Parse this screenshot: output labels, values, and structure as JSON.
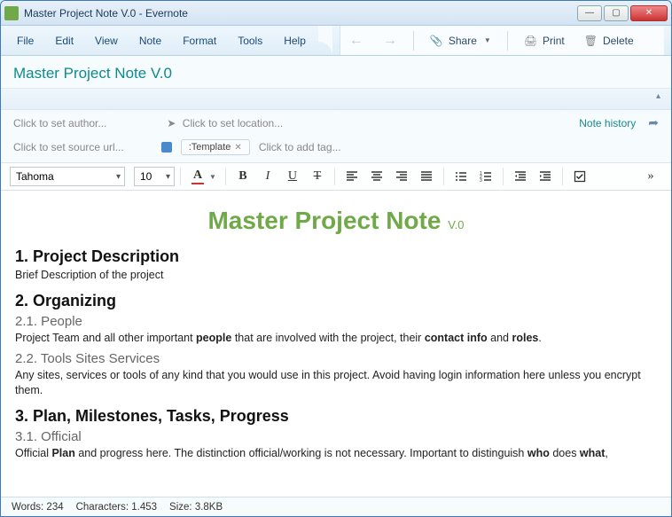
{
  "window": {
    "title": "Master Project Note V.0 - Evernote"
  },
  "menu": {
    "items": [
      "File",
      "Edit",
      "View",
      "Note",
      "Format",
      "Tools",
      "Help"
    ]
  },
  "toolbar": {
    "share": "Share",
    "print": "Print",
    "delete": "Delete"
  },
  "note": {
    "title": "Master Project Note V.0",
    "author_placeholder": "Click to set author...",
    "location_placeholder": "Click to set location...",
    "history_link": "Note history",
    "source_placeholder": "Click to set source url...",
    "tag": ":Template",
    "add_tag_placeholder": "Click to add tag..."
  },
  "format": {
    "font": "Tahoma",
    "size": "10"
  },
  "body": {
    "title": "Master Project Note",
    "version": "V.0",
    "s1_h": "1. Project Description",
    "s1_p": "Brief Description of the project",
    "s2_h": "2. Organizing",
    "s21_h": "2.1. People",
    "s21_p_a": "Project Team and all other important ",
    "s21_p_b": "people",
    "s21_p_c": " that are involved with the project, their ",
    "s21_p_d": "contact info",
    "s21_p_e": " and ",
    "s21_p_f": "roles",
    "s21_p_g": ".",
    "s22_h": "2.2. Tools Sites Services",
    "s22_p": "Any sites, services or tools of any kind that you would use in this project. Avoid having login information here unless you encrypt them.",
    "s3_h": "3. Plan, Milestones, Tasks, Progress",
    "s31_h": "3.1. Official",
    "s31_p_a": "Official ",
    "s31_p_b": "Plan",
    "s31_p_c": " and progress here. The distinction official/working is not necessary. Important to distinguish ",
    "s31_p_d": "who",
    "s31_p_e": " does ",
    "s31_p_f": "what",
    "s31_p_g": ","
  },
  "status": {
    "words_label": "Words:",
    "words": "234",
    "chars_label": "Characters:",
    "chars": "1.453",
    "size_label": "Size:",
    "size": "3.8KB"
  }
}
